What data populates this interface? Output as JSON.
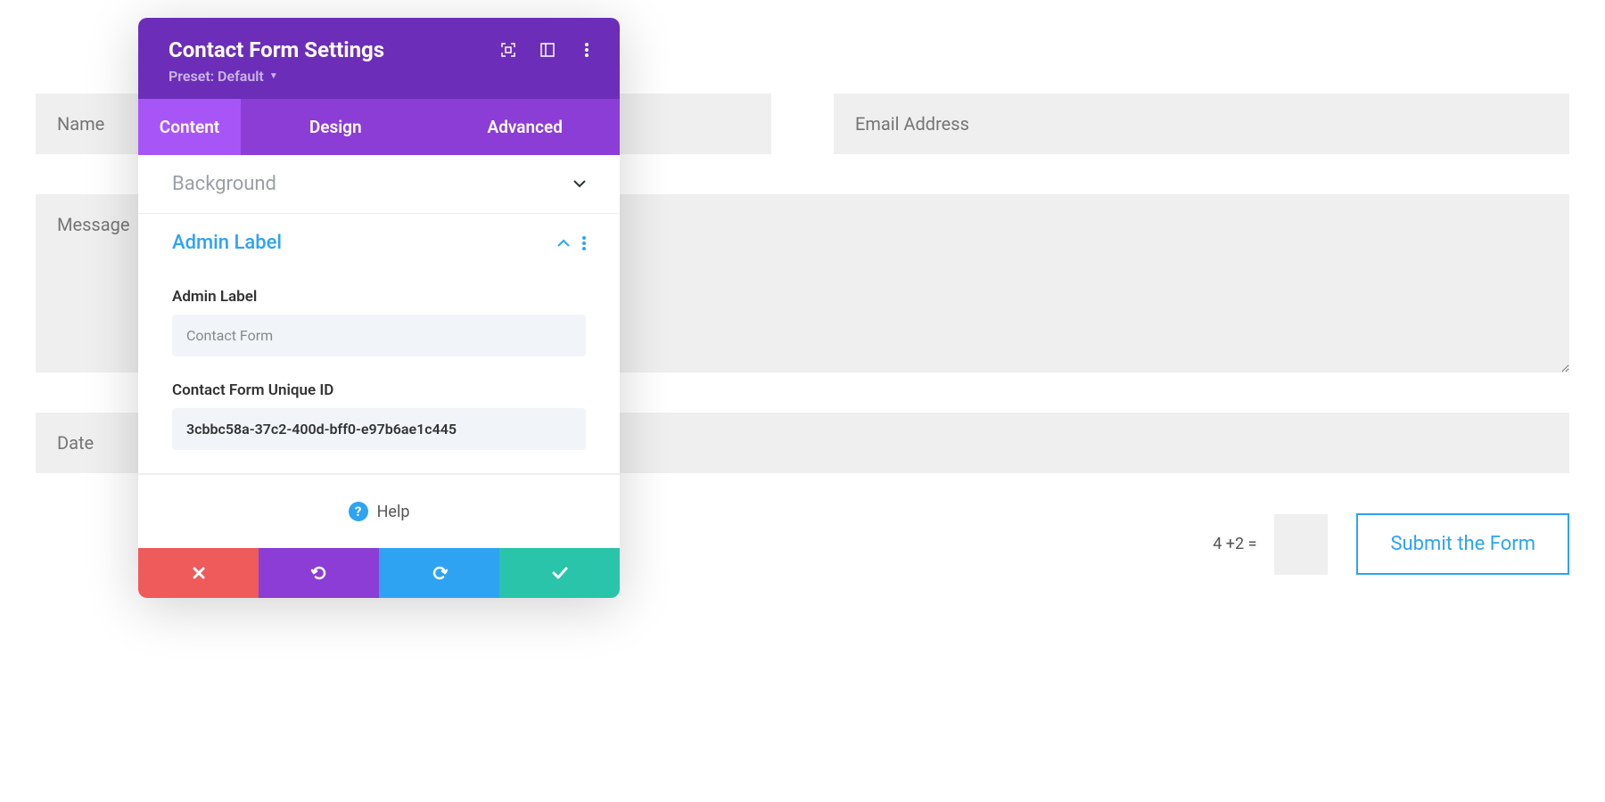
{
  "form": {
    "name_placeholder": "Name",
    "email_placeholder": "Email Address",
    "message_placeholder": "Message",
    "date_placeholder": "Date",
    "captcha_text": "4 +2 =",
    "submit_label": "Submit the Form"
  },
  "panel": {
    "title": "Contact Form Settings",
    "preset_label": "Preset: Default",
    "tabs": {
      "content": "Content",
      "design": "Design",
      "advanced": "Advanced"
    },
    "sections": {
      "background_title": "Background",
      "admin_label_title": "Admin Label",
      "admin_label_field_label": "Admin Label",
      "admin_label_value": "Contact Form",
      "unique_id_label": "Contact Form Unique ID",
      "unique_id_value": "3cbbc58a-37c2-400d-bff0-e97b6ae1c445"
    },
    "help_label": "Help"
  }
}
